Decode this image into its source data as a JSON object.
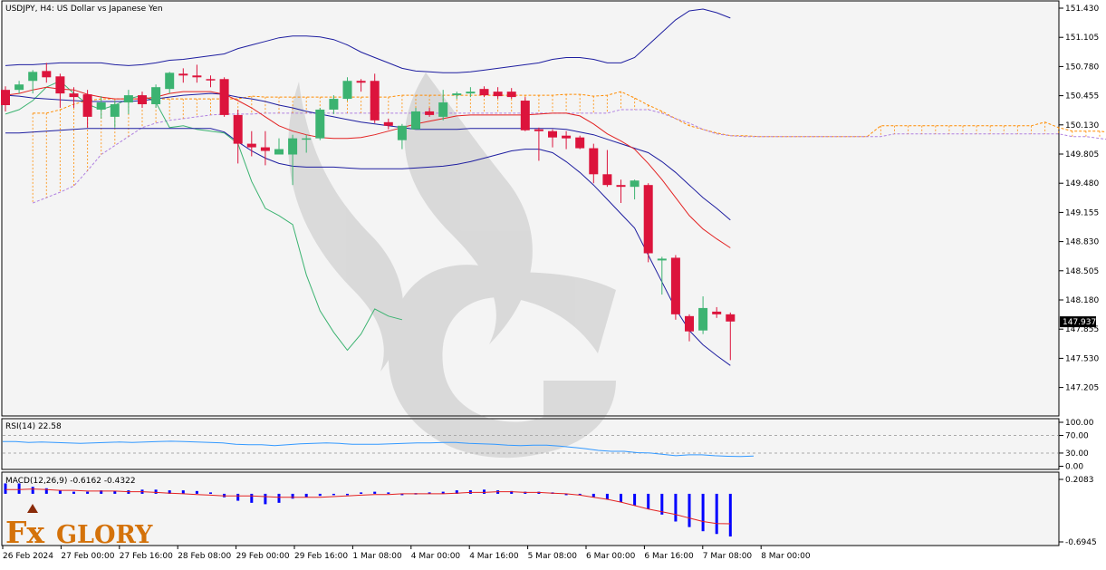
{
  "header": {
    "symbol_label": "USDJPY, H4:  US Dollar vs Japanese Yen"
  },
  "price_axis": {
    "ticks": [
      "151.430",
      "151.105",
      "150.780",
      "150.455",
      "150.130",
      "149.805",
      "149.480",
      "149.155",
      "148.830",
      "148.505",
      "148.180",
      "147.855",
      "147.530",
      "147.205"
    ],
    "current_price": "147.937"
  },
  "rsi_panel": {
    "label": "RSI(14) 22.58",
    "ticks": [
      "100.00",
      "70.00",
      "30.00",
      "0.00"
    ]
  },
  "macd_panel": {
    "label": "MACD(12,26,9) -0.6162 -0.4322",
    "ticks": [
      "0.2083",
      "-0.6945"
    ]
  },
  "time_axis": {
    "labels": [
      "26 Feb 2024",
      "27 Feb 00:00",
      "27 Feb 16:00",
      "28 Feb 08:00",
      "29 Feb 00:00",
      "29 Feb 16:00",
      "1 Mar 08:00",
      "4 Mar 00:00",
      "4 Mar 16:00",
      "5 Mar 08:00",
      "6 Mar 00:00",
      "6 Mar 16:00",
      "7 Mar 08:00",
      "8 Mar 00:00"
    ]
  },
  "logo": {
    "text_fx": "Fx",
    "text_glory": "GLORY"
  },
  "colors": {
    "bull": "#3cb371",
    "bear": "#dc143c",
    "bollinger": "#1e1ea0",
    "ema": "#e32222",
    "cloud": "#ff8c00",
    "chikou": "#3cb371",
    "rsi": "#3399ff",
    "macd_hist": "#0000ff",
    "macd_signal": "#e32222"
  },
  "chart_data": {
    "type": "candlestick",
    "title": "USDJPY, H4:  US Dollar vs Japanese Yen",
    "candles": [
      {
        "o": 150.52,
        "h": 150.56,
        "l": 150.28,
        "c": 150.35
      },
      {
        "o": 150.52,
        "h": 150.62,
        "l": 150.48,
        "c": 150.58
      },
      {
        "o": 150.62,
        "h": 150.74,
        "l": 150.48,
        "c": 150.72
      },
      {
        "o": 150.73,
        "h": 150.82,
        "l": 150.6,
        "c": 150.66
      },
      {
        "o": 150.67,
        "h": 150.7,
        "l": 150.32,
        "c": 150.48
      },
      {
        "o": 150.48,
        "h": 150.55,
        "l": 150.32,
        "c": 150.44
      },
      {
        "o": 150.47,
        "h": 150.52,
        "l": 150.1,
        "c": 150.22
      },
      {
        "o": 150.3,
        "h": 150.45,
        "l": 150.2,
        "c": 150.38
      },
      {
        "o": 150.22,
        "h": 150.4,
        "l": 150.1,
        "c": 150.36
      },
      {
        "o": 150.38,
        "h": 150.52,
        "l": 150.25,
        "c": 150.46
      },
      {
        "o": 150.46,
        "h": 150.5,
        "l": 150.32,
        "c": 150.36
      },
      {
        "o": 150.36,
        "h": 150.58,
        "l": 150.32,
        "c": 150.55
      },
      {
        "o": 150.53,
        "h": 150.72,
        "l": 150.48,
        "c": 150.71
      },
      {
        "o": 150.7,
        "h": 150.76,
        "l": 150.6,
        "c": 150.68
      },
      {
        "o": 150.68,
        "h": 150.8,
        "l": 150.6,
        "c": 150.66
      },
      {
        "o": 150.64,
        "h": 150.68,
        "l": 150.55,
        "c": 150.63
      },
      {
        "o": 150.64,
        "h": 150.66,
        "l": 150.22,
        "c": 150.24
      },
      {
        "o": 150.24,
        "h": 150.3,
        "l": 149.7,
        "c": 149.92
      },
      {
        "o": 149.92,
        "h": 150.06,
        "l": 149.78,
        "c": 149.88
      },
      {
        "o": 149.88,
        "h": 150.06,
        "l": 149.68,
        "c": 149.84
      },
      {
        "o": 149.8,
        "h": 149.98,
        "l": 149.8,
        "c": 149.86
      },
      {
        "o": 149.8,
        "h": 150.02,
        "l": 149.46,
        "c": 149.98
      },
      {
        "o": 149.98,
        "h": 150.02,
        "l": 149.82,
        "c": 149.98
      },
      {
        "o": 149.98,
        "h": 150.32,
        "l": 149.96,
        "c": 150.3
      },
      {
        "o": 150.3,
        "h": 150.46,
        "l": 150.25,
        "c": 150.42
      },
      {
        "o": 150.42,
        "h": 150.66,
        "l": 150.4,
        "c": 150.62
      },
      {
        "o": 150.62,
        "h": 150.64,
        "l": 150.5,
        "c": 150.6
      },
      {
        "o": 150.62,
        "h": 150.7,
        "l": 150.15,
        "c": 150.18
      },
      {
        "o": 150.16,
        "h": 150.2,
        "l": 150.08,
        "c": 150.12
      },
      {
        "o": 149.96,
        "h": 150.14,
        "l": 149.86,
        "c": 150.12
      },
      {
        "o": 150.08,
        "h": 150.32,
        "l": 150.08,
        "c": 150.28
      },
      {
        "o": 150.28,
        "h": 150.32,
        "l": 150.22,
        "c": 150.24
      },
      {
        "o": 150.22,
        "h": 150.52,
        "l": 150.18,
        "c": 150.38
      },
      {
        "o": 150.46,
        "h": 150.5,
        "l": 150.42,
        "c": 150.48
      },
      {
        "o": 150.48,
        "h": 150.55,
        "l": 150.44,
        "c": 150.5
      },
      {
        "o": 150.53,
        "h": 150.56,
        "l": 150.44,
        "c": 150.46
      },
      {
        "o": 150.5,
        "h": 150.55,
        "l": 150.42,
        "c": 150.45
      },
      {
        "o": 150.5,
        "h": 150.54,
        "l": 150.42,
        "c": 150.44
      },
      {
        "o": 150.4,
        "h": 150.44,
        "l": 150.06,
        "c": 150.07
      },
      {
        "o": 150.08,
        "h": 150.1,
        "l": 149.73,
        "c": 150.06
      },
      {
        "o": 150.06,
        "h": 150.08,
        "l": 149.88,
        "c": 149.99
      },
      {
        "o": 150.01,
        "h": 150.06,
        "l": 149.86,
        "c": 149.98
      },
      {
        "o": 149.99,
        "h": 150.01,
        "l": 149.86,
        "c": 149.87
      },
      {
        "o": 149.87,
        "h": 149.92,
        "l": 149.48,
        "c": 149.58
      },
      {
        "o": 149.58,
        "h": 149.85,
        "l": 149.44,
        "c": 149.46
      },
      {
        "o": 149.46,
        "h": 149.52,
        "l": 149.26,
        "c": 149.44
      },
      {
        "o": 149.44,
        "h": 149.52,
        "l": 149.3,
        "c": 149.51
      },
      {
        "o": 149.46,
        "h": 149.48,
        "l": 148.6,
        "c": 148.7
      },
      {
        "o": 148.62,
        "h": 148.66,
        "l": 148.24,
        "c": 148.64
      },
      {
        "o": 148.65,
        "h": 148.68,
        "l": 147.96,
        "c": 148.02
      },
      {
        "o": 148.0,
        "h": 148.02,
        "l": 147.72,
        "c": 147.83
      },
      {
        "o": 147.84,
        "h": 148.22,
        "l": 147.8,
        "c": 148.09
      },
      {
        "o": 148.05,
        "h": 148.1,
        "l": 147.98,
        "c": 148.02
      },
      {
        "o": 148.02,
        "h": 148.04,
        "l": 147.51,
        "c": 147.94
      }
    ],
    "last_price": 147.937,
    "ylim": [
      147.02,
      151.52
    ],
    "bollinger_upper": [
      150.79,
      150.8,
      150.8,
      150.81,
      150.82,
      150.82,
      150.82,
      150.82,
      150.8,
      150.79,
      150.8,
      150.82,
      150.85,
      150.86,
      150.88,
      150.9,
      150.92,
      150.98,
      151.02,
      151.06,
      151.1,
      151.12,
      151.12,
      151.11,
      151.08,
      151.02,
      150.94,
      150.88,
      150.82,
      150.76,
      150.73,
      150.72,
      150.71,
      150.71,
      150.72,
      150.74,
      150.76,
      150.78,
      150.8,
      150.82,
      150.86,
      150.88,
      150.88,
      150.86,
      150.82,
      150.82,
      150.88,
      151.02,
      151.16,
      151.3,
      151.4,
      151.42,
      151.38,
      151.32
    ],
    "bollinger_mid": [
      150.46,
      150.45,
      150.43,
      150.42,
      150.41,
      150.4,
      150.39,
      150.39,
      150.39,
      150.39,
      150.4,
      150.42,
      150.44,
      150.46,
      150.47,
      150.48,
      150.47,
      150.44,
      150.42,
      150.39,
      150.35,
      150.32,
      150.28,
      150.25,
      150.22,
      150.19,
      150.16,
      150.14,
      150.12,
      150.1,
      150.08,
      150.08,
      150.08,
      150.08,
      150.09,
      150.09,
      150.09,
      150.09,
      150.09,
      150.09,
      150.09,
      150.08,
      150.05,
      150.02,
      149.97,
      149.92,
      149.87,
      149.82,
      149.72,
      149.6,
      149.46,
      149.32,
      149.2,
      149.07
    ],
    "bollinger_lower": [
      150.04,
      150.04,
      150.05,
      150.06,
      150.07,
      150.08,
      150.09,
      150.09,
      150.09,
      150.09,
      150.09,
      150.09,
      150.09,
      150.09,
      150.09,
      150.09,
      150.05,
      149.94,
      149.84,
      149.76,
      149.7,
      149.67,
      149.66,
      149.66,
      149.66,
      149.65,
      149.64,
      149.64,
      149.64,
      149.64,
      149.65,
      149.66,
      149.67,
      149.69,
      149.72,
      149.76,
      149.8,
      149.84,
      149.86,
      149.86,
      149.82,
      149.72,
      149.6,
      149.46,
      149.3,
      149.14,
      148.98,
      148.68,
      148.38,
      148.08,
      147.84,
      147.68,
      147.56,
      147.45
    ],
    "ema": [
      150.46,
      150.48,
      150.52,
      150.55,
      150.53,
      150.52,
      150.47,
      150.44,
      150.42,
      150.42,
      150.42,
      150.44,
      150.48,
      150.5,
      150.5,
      150.5,
      150.47,
      150.4,
      150.32,
      150.22,
      150.12,
      150.06,
      150.02,
      149.99,
      149.98,
      149.98,
      149.99,
      150.02,
      150.06,
      150.1,
      150.14,
      150.17,
      150.2,
      150.23,
      150.24,
      150.24,
      150.24,
      150.24,
      150.24,
      150.25,
      150.26,
      150.26,
      150.23,
      150.14,
      150.03,
      149.95,
      149.86,
      149.7,
      149.52,
      149.32,
      149.12,
      148.97,
      148.86,
      148.76
    ],
    "cloud_top": [
      150.26,
      150.26,
      150.3,
      150.36,
      150.4,
      150.42,
      150.42,
      150.42,
      150.42,
      150.42,
      150.42,
      150.42,
      150.42,
      150.42,
      150.42,
      150.42,
      150.45,
      150.44,
      150.44,
      150.44,
      150.44,
      150.44,
      150.44,
      150.44,
      150.44,
      150.44,
      150.44,
      150.46,
      150.46,
      150.46,
      150.46,
      150.46,
      150.46,
      150.46,
      150.46,
      150.46,
      150.46,
      150.46,
      150.46,
      150.47,
      150.47,
      150.45,
      150.46,
      150.5,
      150.43,
      150.35,
      150.28,
      150.2,
      150.12,
      150.08,
      150.04,
      150.01,
      150.01,
      150.0,
      150.0,
      150.0,
      150.0,
      150.0,
      150.0,
      150.0,
      150.0,
      150.0,
      150.12,
      150.12,
      150.12,
      150.12,
      150.12,
      150.12,
      150.12,
      150.12,
      150.12,
      150.12,
      150.12,
      150.12,
      150.16,
      150.1,
      150.06,
      150.06,
      150.06,
      150.04,
      150.02,
      150.0,
      149.98,
      149.95,
      149.94,
      149.88,
      149.55
    ],
    "cloud_bottom": [
      149.26,
      149.32,
      149.38,
      149.45,
      149.62,
      149.8,
      149.9,
      150.0,
      150.1,
      150.15,
      150.18,
      150.2,
      150.22,
      150.24,
      150.25,
      150.25,
      150.25,
      150.26,
      150.26,
      150.26,
      150.26,
      150.26,
      150.26,
      150.26,
      150.26,
      150.26,
      150.26,
      150.26,
      150.26,
      150.26,
      150.26,
      150.26,
      150.26,
      150.26,
      150.26,
      150.26,
      150.26,
      150.26,
      150.26,
      150.26,
      150.26,
      150.26,
      150.26,
      150.3,
      150.3,
      150.3,
      150.26,
      150.2,
      150.15,
      150.08,
      150.03,
      150.01,
      150.0,
      150.0,
      150.0,
      150.0,
      150.0,
      150.0,
      150.0,
      150.0,
      150.0,
      150.0,
      150.0,
      150.03,
      150.03,
      150.03,
      150.03,
      150.03,
      150.03,
      150.03,
      150.03,
      150.03,
      150.03,
      150.03,
      150.03,
      150.03,
      150.0,
      150.0,
      149.98,
      149.96,
      149.96,
      149.96,
      149.94,
      149.96,
      149.94,
      149.88,
      149.55
    ],
    "chikou": [
      150.25,
      150.3,
      150.4,
      150.55,
      150.62,
      150.48,
      150.36,
      150.3,
      150.35,
      150.42,
      150.46,
      150.38,
      150.1,
      150.12,
      150.08,
      150.06,
      150.04,
      149.92,
      149.5,
      149.2,
      149.12,
      149.02,
      148.46,
      148.06,
      147.82,
      147.62,
      147.8,
      148.08,
      148.0,
      147.96
    ],
    "rsi": [
      56,
      56,
      54,
      55,
      54,
      53,
      52,
      53,
      54,
      55,
      54,
      55,
      56,
      57,
      56,
      55,
      54,
      53,
      50,
      49,
      49,
      47,
      49,
      51,
      52,
      53,
      52,
      50,
      50,
      50,
      51,
      52,
      53,
      53,
      54,
      54,
      52,
      51,
      50,
      48,
      47,
      48,
      48,
      46,
      43,
      40,
      36,
      34,
      34,
      31,
      30,
      27,
      24,
      26,
      26,
      24,
      22.58,
      22,
      23
    ],
    "rsi_ticks": [
      100,
      70,
      30,
      0
    ],
    "macd_ylim": [
      -0.6945,
      0.2083
    ],
    "macd_hist": [
      0.15,
      0.15,
      0.1,
      0.08,
      0.05,
      0.03,
      0.03,
      0.05,
      0.04,
      0.05,
      0.06,
      0.06,
      0.05,
      0.05,
      0.04,
      0.02,
      -0.05,
      -0.1,
      -0.13,
      -0.15,
      -0.13,
      -0.07,
      -0.05,
      -0.03,
      -0.01,
      0.0,
      0.02,
      0.03,
      0.02,
      0.0,
      0.01,
      0.02,
      0.03,
      0.05,
      0.05,
      0.06,
      0.05,
      0.04,
      0.03,
      0.03,
      0.02,
      0.0,
      -0.02,
      -0.05,
      -0.08,
      -0.12,
      -0.17,
      -0.22,
      -0.3,
      -0.4,
      -0.48,
      -0.54,
      -0.58,
      -0.6162
    ],
    "macd_signal": [
      0.06,
      0.06,
      0.07,
      0.06,
      0.05,
      0.05,
      0.04,
      0.04,
      0.04,
      0.03,
      0.03,
      0.02,
      0.01,
      0.0,
      -0.01,
      -0.02,
      -0.03,
      -0.03,
      -0.03,
      -0.04,
      -0.05,
      -0.05,
      -0.05,
      -0.05,
      -0.04,
      -0.03,
      -0.02,
      -0.01,
      -0.01,
      0.0,
      0.0,
      0.0,
      0.0,
      0.01,
      0.02,
      0.02,
      0.03,
      0.03,
      0.02,
      0.02,
      0.01,
      0.0,
      -0.02,
      -0.05,
      -0.08,
      -0.12,
      -0.17,
      -0.22,
      -0.26,
      -0.3,
      -0.35,
      -0.4,
      -0.43,
      -0.4322
    ]
  }
}
